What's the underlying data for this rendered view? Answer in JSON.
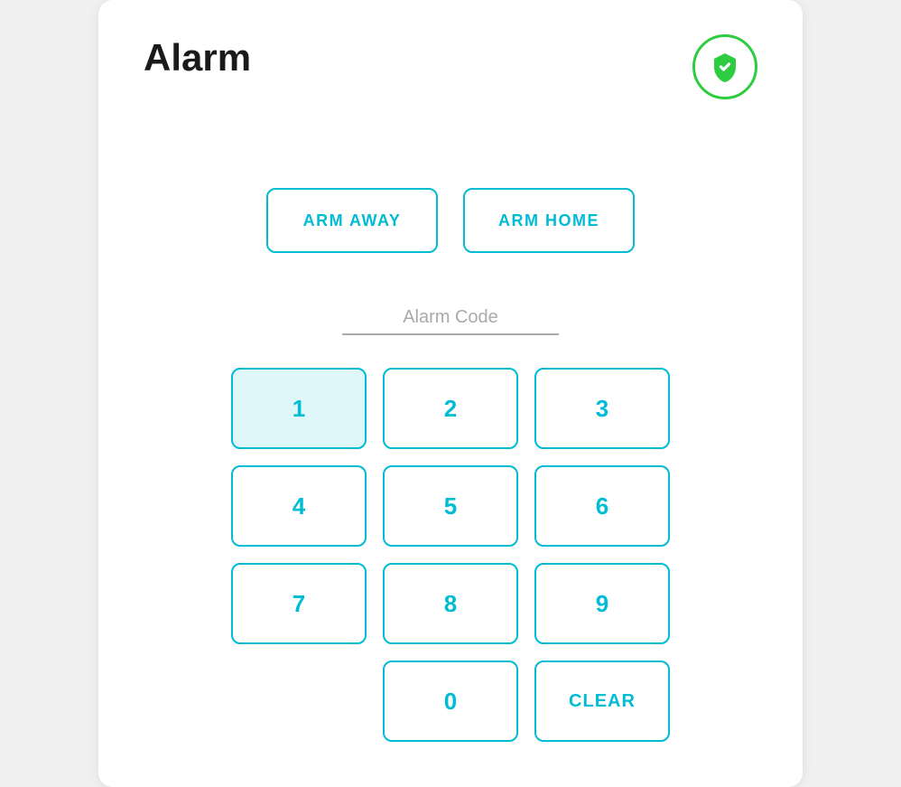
{
  "page": {
    "title": "Alarm"
  },
  "header": {
    "shield_status": "armed",
    "shield_icon": "shield-check-icon"
  },
  "arm_buttons": {
    "arm_away_label": "ARM AWAY",
    "arm_home_label": "ARM HOME"
  },
  "alarm_code_field": {
    "placeholder": "Alarm Code",
    "value": ""
  },
  "keypad": {
    "keys": [
      "1",
      "2",
      "3",
      "4",
      "5",
      "6",
      "7",
      "8",
      "9"
    ],
    "key_0_label": "0",
    "clear_label": "CLEAR"
  }
}
